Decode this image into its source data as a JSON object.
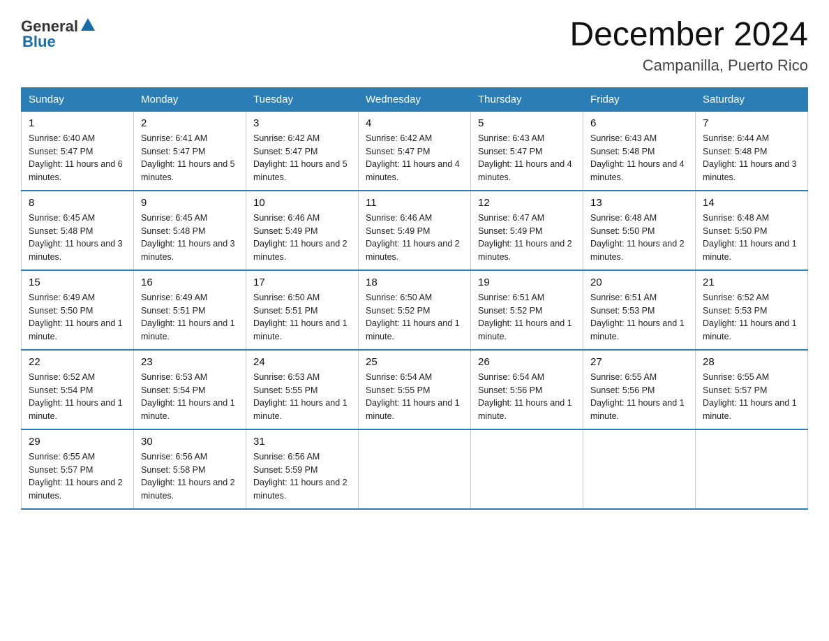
{
  "header": {
    "logo": {
      "general": "General",
      "blue": "Blue"
    },
    "title": "December 2024",
    "subtitle": "Campanilla, Puerto Rico"
  },
  "days_of_week": [
    "Sunday",
    "Monday",
    "Tuesday",
    "Wednesday",
    "Thursday",
    "Friday",
    "Saturday"
  ],
  "weeks": [
    [
      {
        "day": "1",
        "sunrise": "6:40 AM",
        "sunset": "5:47 PM",
        "daylight": "11 hours and 6 minutes."
      },
      {
        "day": "2",
        "sunrise": "6:41 AM",
        "sunset": "5:47 PM",
        "daylight": "11 hours and 5 minutes."
      },
      {
        "day": "3",
        "sunrise": "6:42 AM",
        "sunset": "5:47 PM",
        "daylight": "11 hours and 5 minutes."
      },
      {
        "day": "4",
        "sunrise": "6:42 AM",
        "sunset": "5:47 PM",
        "daylight": "11 hours and 4 minutes."
      },
      {
        "day": "5",
        "sunrise": "6:43 AM",
        "sunset": "5:47 PM",
        "daylight": "11 hours and 4 minutes."
      },
      {
        "day": "6",
        "sunrise": "6:43 AM",
        "sunset": "5:48 PM",
        "daylight": "11 hours and 4 minutes."
      },
      {
        "day": "7",
        "sunrise": "6:44 AM",
        "sunset": "5:48 PM",
        "daylight": "11 hours and 3 minutes."
      }
    ],
    [
      {
        "day": "8",
        "sunrise": "6:45 AM",
        "sunset": "5:48 PM",
        "daylight": "11 hours and 3 minutes."
      },
      {
        "day": "9",
        "sunrise": "6:45 AM",
        "sunset": "5:48 PM",
        "daylight": "11 hours and 3 minutes."
      },
      {
        "day": "10",
        "sunrise": "6:46 AM",
        "sunset": "5:49 PM",
        "daylight": "11 hours and 2 minutes."
      },
      {
        "day": "11",
        "sunrise": "6:46 AM",
        "sunset": "5:49 PM",
        "daylight": "11 hours and 2 minutes."
      },
      {
        "day": "12",
        "sunrise": "6:47 AM",
        "sunset": "5:49 PM",
        "daylight": "11 hours and 2 minutes."
      },
      {
        "day": "13",
        "sunrise": "6:48 AM",
        "sunset": "5:50 PM",
        "daylight": "11 hours and 2 minutes."
      },
      {
        "day": "14",
        "sunrise": "6:48 AM",
        "sunset": "5:50 PM",
        "daylight": "11 hours and 1 minute."
      }
    ],
    [
      {
        "day": "15",
        "sunrise": "6:49 AM",
        "sunset": "5:50 PM",
        "daylight": "11 hours and 1 minute."
      },
      {
        "day": "16",
        "sunrise": "6:49 AM",
        "sunset": "5:51 PM",
        "daylight": "11 hours and 1 minute."
      },
      {
        "day": "17",
        "sunrise": "6:50 AM",
        "sunset": "5:51 PM",
        "daylight": "11 hours and 1 minute."
      },
      {
        "day": "18",
        "sunrise": "6:50 AM",
        "sunset": "5:52 PM",
        "daylight": "11 hours and 1 minute."
      },
      {
        "day": "19",
        "sunrise": "6:51 AM",
        "sunset": "5:52 PM",
        "daylight": "11 hours and 1 minute."
      },
      {
        "day": "20",
        "sunrise": "6:51 AM",
        "sunset": "5:53 PM",
        "daylight": "11 hours and 1 minute."
      },
      {
        "day": "21",
        "sunrise": "6:52 AM",
        "sunset": "5:53 PM",
        "daylight": "11 hours and 1 minute."
      }
    ],
    [
      {
        "day": "22",
        "sunrise": "6:52 AM",
        "sunset": "5:54 PM",
        "daylight": "11 hours and 1 minute."
      },
      {
        "day": "23",
        "sunrise": "6:53 AM",
        "sunset": "5:54 PM",
        "daylight": "11 hours and 1 minute."
      },
      {
        "day": "24",
        "sunrise": "6:53 AM",
        "sunset": "5:55 PM",
        "daylight": "11 hours and 1 minute."
      },
      {
        "day": "25",
        "sunrise": "6:54 AM",
        "sunset": "5:55 PM",
        "daylight": "11 hours and 1 minute."
      },
      {
        "day": "26",
        "sunrise": "6:54 AM",
        "sunset": "5:56 PM",
        "daylight": "11 hours and 1 minute."
      },
      {
        "day": "27",
        "sunrise": "6:55 AM",
        "sunset": "5:56 PM",
        "daylight": "11 hours and 1 minute."
      },
      {
        "day": "28",
        "sunrise": "6:55 AM",
        "sunset": "5:57 PM",
        "daylight": "11 hours and 1 minute."
      }
    ],
    [
      {
        "day": "29",
        "sunrise": "6:55 AM",
        "sunset": "5:57 PM",
        "daylight": "11 hours and 2 minutes."
      },
      {
        "day": "30",
        "sunrise": "6:56 AM",
        "sunset": "5:58 PM",
        "daylight": "11 hours and 2 minutes."
      },
      {
        "day": "31",
        "sunrise": "6:56 AM",
        "sunset": "5:59 PM",
        "daylight": "11 hours and 2 minutes."
      },
      null,
      null,
      null,
      null
    ]
  ],
  "labels": {
    "sunrise": "Sunrise:",
    "sunset": "Sunset:",
    "daylight": "Daylight:"
  }
}
